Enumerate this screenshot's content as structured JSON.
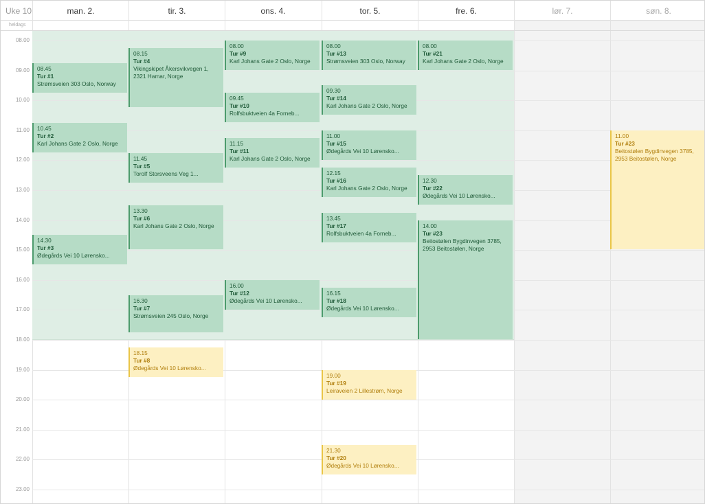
{
  "calendar": {
    "week_label": "Uke 10",
    "allday_label": "heldags",
    "days": [
      {
        "label": "man. 2.",
        "weekend": false
      },
      {
        "label": "tir. 3.",
        "weekend": false
      },
      {
        "label": "ons. 4.",
        "weekend": false
      },
      {
        "label": "tor. 5.",
        "weekend": false
      },
      {
        "label": "fre. 6.",
        "weekend": false
      },
      {
        "label": "lør. 7.",
        "weekend": true
      },
      {
        "label": "søn. 8.",
        "weekend": true
      }
    ],
    "times": [
      "08.00",
      "09.00",
      "10.00",
      "11.00",
      "12.00",
      "13.00",
      "14.00",
      "15.00",
      "16.00",
      "17.00",
      "18.00",
      "19.00",
      "20.00",
      "21.00",
      "22.00",
      "23.00"
    ]
  },
  "colors": {
    "green_event": "#b6dcc6",
    "green_border": "#4c9b6c",
    "yellow_event": "#fdf0c2",
    "yellow_border": "#e9c546"
  },
  "events": [
    {
      "day": 0,
      "start": "08.45",
      "end": "09.45",
      "time": "08.45",
      "title": "Tur #1",
      "address": "Strømsveien 303 Oslo, Norway",
      "status": "green"
    },
    {
      "day": 0,
      "start": "10.45",
      "end": "11.45",
      "time": "10.45",
      "title": "Tur #2",
      "address": "Karl Johans Gate 2 Oslo, Norge",
      "status": "green"
    },
    {
      "day": 0,
      "start": "14.30",
      "end": "15.30",
      "time": "14.30",
      "title": "Tur #3",
      "address": "Ødegårds Vei 10 Lørensko...",
      "status": "green"
    },
    {
      "day": 1,
      "start": "08.15",
      "end": "10.15",
      "time": "08.15",
      "title": "Tur #4",
      "address": "Vikingskipet Åkersvikvegen 1,\n2321 Hamar, Norge",
      "status": "green"
    },
    {
      "day": 1,
      "start": "11.45",
      "end": "12.45",
      "time": "11.45",
      "title": "Tur #5",
      "address": "Torolf Storsveens Veg 1...",
      "status": "green"
    },
    {
      "day": 1,
      "start": "13.30",
      "end": "15.00",
      "time": "13.30",
      "title": "Tur #6",
      "address": "Karl Johans Gate 2 Oslo, Norge",
      "status": "green"
    },
    {
      "day": 1,
      "start": "16.30",
      "end": "17.45",
      "time": "16.30",
      "title": "Tur #7",
      "address": "Strømsveien 245 Oslo, Norge",
      "status": "green"
    },
    {
      "day": 1,
      "start": "18.15",
      "end": "19.15",
      "time": "18.15",
      "title": "Tur #8",
      "address": "Ødegårds Vei 10 Lørensko...",
      "status": "yellow"
    },
    {
      "day": 2,
      "start": "08.00",
      "end": "09.00",
      "time": "08.00",
      "title": "Tur #9",
      "address": "Karl Johans Gate 2 Oslo, Norge",
      "status": "green"
    },
    {
      "day": 2,
      "start": "09.45",
      "end": "10.45",
      "time": "09.45",
      "title": "Tur #10",
      "address": "Rolfsbuktveien 4a Forneb...",
      "status": "green"
    },
    {
      "day": 2,
      "start": "11.15",
      "end": "12.15",
      "time": "11.15",
      "title": "Tur #11",
      "address": "Karl Johans Gate 2 Oslo, Norge",
      "status": "green"
    },
    {
      "day": 2,
      "start": "16.00",
      "end": "17.00",
      "time": "16.00",
      "title": "Tur #12",
      "address": "Ødegårds Vei 10 Lørensko...",
      "status": "green"
    },
    {
      "day": 3,
      "start": "08.00",
      "end": "09.00",
      "time": "08.00",
      "title": "Tur #13",
      "address": "Strømsveien 303 Oslo, Norway",
      "status": "green"
    },
    {
      "day": 3,
      "start": "09.30",
      "end": "10.30",
      "time": "09.30",
      "title": "Tur #14",
      "address": "Karl Johans Gate 2 Oslo, Norge",
      "status": "green"
    },
    {
      "day": 3,
      "start": "11.00",
      "end": "12.00",
      "time": "11.00",
      "title": "Tur #15",
      "address": "Ødegårds Vei 10 Lørensko...",
      "status": "green"
    },
    {
      "day": 3,
      "start": "12.15",
      "end": "13.15",
      "time": "12.15",
      "title": "Tur #16",
      "address": "Karl Johans Gate 2 Oslo, Norge",
      "status": "green"
    },
    {
      "day": 3,
      "start": "13.45",
      "end": "14.45",
      "time": "13.45",
      "title": "Tur #17",
      "address": "Rolfsbuktveien 4a Forneb...",
      "status": "green"
    },
    {
      "day": 3,
      "start": "16.15",
      "end": "17.15",
      "time": "16.15",
      "title": "Tur #18",
      "address": "Ødegårds Vei 10 Lørensko...",
      "status": "green"
    },
    {
      "day": 3,
      "start": "19.00",
      "end": "20.00",
      "time": "19.00",
      "title": "Tur #19",
      "address": "Leiraveien 2 Lillestrøm, Norge",
      "status": "yellow"
    },
    {
      "day": 3,
      "start": "21.30",
      "end": "22.30",
      "time": "21.30",
      "title": "Tur #20",
      "address": "Ødegårds Vei 10 Lørensko...",
      "status": "yellow"
    },
    {
      "day": 4,
      "start": "08.00",
      "end": "09.00",
      "time": "08.00",
      "title": "Tur #21",
      "address": "Karl Johans Gate 2 Oslo, Norge",
      "status": "green"
    },
    {
      "day": 4,
      "start": "12.30",
      "end": "13.30",
      "time": "12.30",
      "title": "Tur #22",
      "address": "Ødegårds Vei 10 Lørensko...",
      "status": "green"
    },
    {
      "day": 4,
      "start": "14.00",
      "end": "18.00",
      "time": "14.00",
      "title": "Tur #23",
      "address": "Beitostølen Bygdinvegen 3785,\n2953 Beitostølen, Norge",
      "status": "green"
    },
    {
      "day": 6,
      "start": "11.00",
      "end": "15.00",
      "time": "11.00",
      "title": "Tur #23",
      "address": "Beitostølen Bygdinvegen 3785,\n2953 Beitostølen, Norge",
      "status": "yellow"
    }
  ]
}
